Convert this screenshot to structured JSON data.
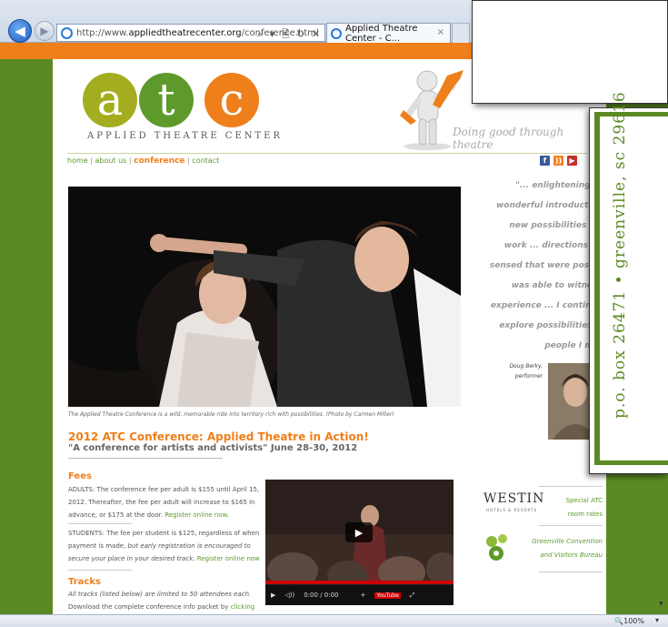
{
  "browser": {
    "url_prefix": "http://www.",
    "url_domain": "appliedtheatrecenter.org",
    "url_path": "/conference.html",
    "address_tools": "⌕ ▾ 🖹 ↻ ✕",
    "tab_title": "Applied Theatre Center - C...",
    "tab_close": "×",
    "zoom": "🔍100%",
    "zoom_dropdown": "▾"
  },
  "site": {
    "logo_letters": [
      "a",
      "t",
      "c"
    ],
    "logo_text": "APPLIED THEATRE CENTER",
    "tagline": "Doing good through theatre",
    "nav": {
      "home": "home",
      "about": "about us",
      "conference": "conference",
      "contact": "contact",
      "sep": "|"
    },
    "social": [
      "f",
      "))",
      "▶"
    ]
  },
  "hero": {
    "caption": "The Applied Theatre Conference is a wild, memorable ride into territory rich with possibilities. (Photo by Carmen Miller)"
  },
  "conference": {
    "title": "2012 ATC Conference: Applied Theatre in Action!",
    "subtitle": "\"A conference for artists and activists\" June 28-30, 2012"
  },
  "fees": {
    "heading": "Fees",
    "adults_1": "ADULTS: The conference fee per adult is $155 until April 15,",
    "adults_2": "2012. Thereafter, the fee per adult will increase to $165 in",
    "adults_3": "advance, or $175 at the door.",
    "adults_link": "Register online now",
    "students_1": "STUDENTS: The fee per student is $125, regardless of when",
    "students_2": "payment is made,",
    "students_2_em": "but early registration is encouraged to",
    "students_3_em": "secure your place in your desired track.",
    "students_link": "Register online now"
  },
  "tracks": {
    "heading": "Tracks",
    "line1": "All tracks (listed below) are limited to 50 attendees each.",
    "line2": "Download the complete conference info packet by",
    "line2_link": "clicking"
  },
  "video": {
    "time": "0:00 / 0:00",
    "brand": "YouTube",
    "play": "▶"
  },
  "quote": {
    "lines": [
      "\"... enlightening ...",
      "wonderful introduction",
      "new possibilities for",
      "work ... directions I h",
      "sensed that were possib",
      "was able to witness",
      "experience ... I continue",
      "explore possibilities w",
      "people I met"
    ],
    "author": "Doug Berky,",
    "author_role": "performer"
  },
  "sidebar": {
    "westin_logo": "WESTIN",
    "westin_sub": "HOTELS & RESORTS",
    "westin_link_1": "Special ATC",
    "westin_link_2": "room rates",
    "gcvb_link_1": "Greenville Convention",
    "gcvb_link_2": "and Visitors Bureau"
  },
  "card": {
    "address": "p.o. box 26471 • greenville, sc 29616"
  },
  "colors": {
    "brand_green": "#5b8a24",
    "brand_orange": "#ef7f1a",
    "logo_olive": "#a4ad1d"
  }
}
